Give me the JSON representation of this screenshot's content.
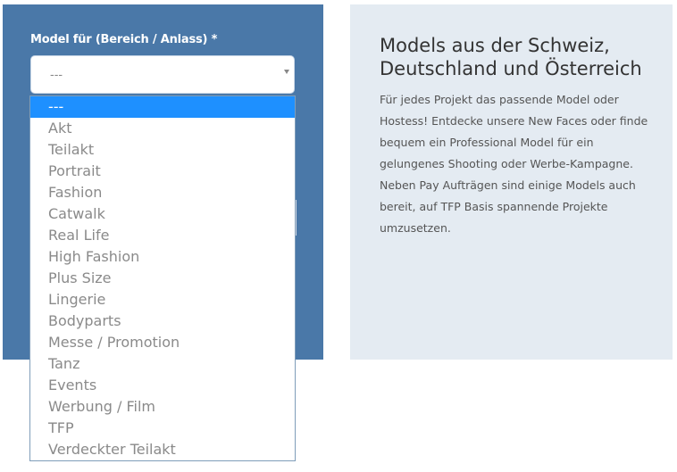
{
  "form": {
    "label": "Model für (Bereich / Anlass) *",
    "select": {
      "current_value": "---",
      "options": [
        "---",
        "Akt",
        "Teilakt",
        "Portrait",
        "Fashion",
        "Catwalk",
        "Real Life",
        "High Fashion",
        "Plus Size",
        "Lingerie",
        "Bodyparts",
        "Messe / Promotion",
        "Tanz",
        "Events",
        "Werbung / Film",
        "TFP",
        "Verdeckter Teilakt"
      ],
      "highlighted_index": 0
    }
  },
  "info": {
    "title": "Models aus der Schweiz, Deutschland und Österreich",
    "text": "Für jedes Projekt das passende Model oder Hostess! Entdecke unsere New Faces oder finde bequem ein Professional Model für ein gelungenes Shooting oder Werbe-Kampagne. Neben Pay Aufträgen sind einige Models auch bereit, auf TFP Basis spannende Projekte umzusetzen."
  },
  "colors": {
    "form_panel": "#4a78a8",
    "info_panel": "#e4ebf2",
    "highlight": "#1e90ff"
  }
}
